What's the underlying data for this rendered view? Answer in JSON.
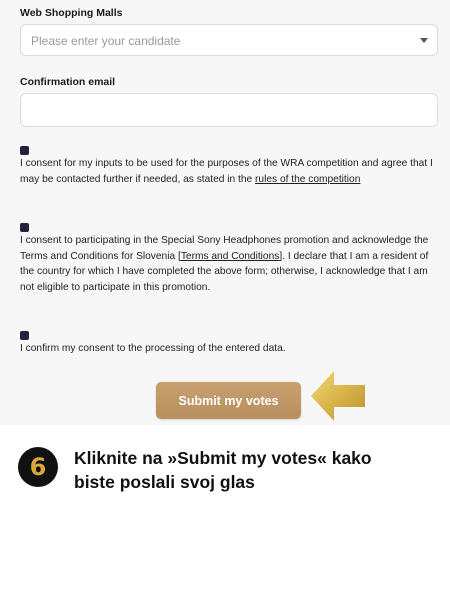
{
  "form": {
    "malls_label": "Web Shopping Malls",
    "malls_select": {
      "placeholder": "Please enter your candidate"
    },
    "email_label": "Confirmation email",
    "email_value": ""
  },
  "consents": [
    {
      "text_before": "I consent for my inputs to be used for the purposes of the WRA competition and agree that I may be contacted further if needed, as stated in the ",
      "link": "rules of the competition",
      "text_after": ""
    },
    {
      "text_before": "I consent to participating in the Special Sony Headphones promotion and acknowledge the Terms and Conditions for Slovenia ",
      "link": "[Terms and Conditions]",
      "text_after": ". I declare that I am a resident of the country for which I have completed the above form; otherwise, I acknowledge that I am not eligible to participate in this promotion."
    },
    {
      "text_before": "I confirm my consent to the processing of the entered data.",
      "link": "",
      "text_after": ""
    }
  ],
  "submit_label": "Submit my votes",
  "step": {
    "number": "6",
    "instruction": "Kliknite na »Submit my votes« kako biste poslali svoj glas"
  },
  "colors": {
    "button": "#c19868",
    "arrow": "#d9b54a",
    "badge_digit": "#d9a73c",
    "checkbox": "#2a1f3a"
  },
  "icons": {
    "select_chevron": "chevron-down-icon",
    "pointer": "arrow-left-icon"
  }
}
